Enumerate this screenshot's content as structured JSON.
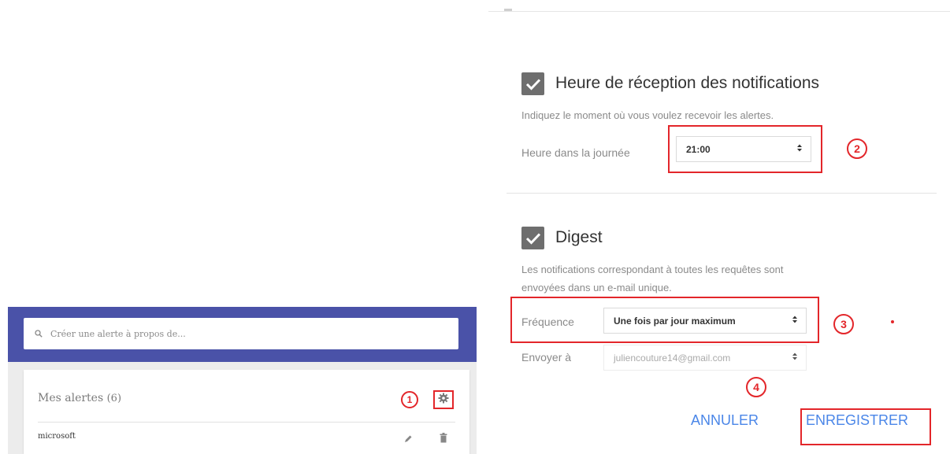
{
  "left_panel": {
    "search_placeholder": "Créer une alerte à propos de...",
    "my_alerts_title": "Mes alertes",
    "my_alerts_count": "(6)",
    "alerts": [
      {
        "name": "microsoft"
      }
    ],
    "annotation_1": "1"
  },
  "right_panel": {
    "delivery_time": {
      "title": "Heure de réception des notifications",
      "description": "Indiquez le moment où vous voulez recevoir les alertes.",
      "label": "Heure dans la journée",
      "value": "21:00",
      "checked": true,
      "annotation": "2"
    },
    "digest": {
      "title": "Digest",
      "description_line1": "Les notifications correspondant à toutes les requêtes sont",
      "description_line2": "envoyées dans un e-mail unique.",
      "frequency_label": "Fréquence",
      "frequency_value": "Une fois par jour maximum",
      "frequency_annotation": "3",
      "send_to_label": "Envoyer à",
      "send_to_value": "juliencouture14@gmail.com",
      "checked": true
    },
    "cancel_label": "ANNULER",
    "save_label": "ENREGISTRER",
    "save_annotation": "4"
  },
  "colors": {
    "header_blue": "#4a52a8",
    "annotation_red": "#e3262a",
    "button_blue": "#4a86e8",
    "checkbox_gray": "#6e6e6e"
  }
}
